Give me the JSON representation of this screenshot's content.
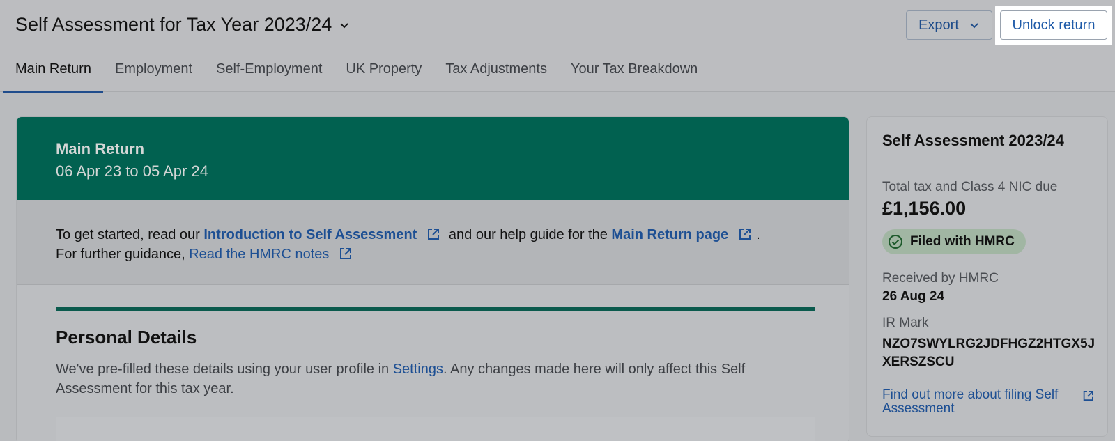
{
  "header": {
    "title": "Self Assessment for Tax Year 2023/24",
    "export_label": "Export",
    "unlock_label": "Unlock return"
  },
  "tabs": [
    {
      "label": "Main Return",
      "active": true
    },
    {
      "label": "Employment",
      "active": false
    },
    {
      "label": "Self-Employment",
      "active": false
    },
    {
      "label": "UK Property",
      "active": false
    },
    {
      "label": "Tax Adjustments",
      "active": false
    },
    {
      "label": "Your Tax Breakdown",
      "active": false
    }
  ],
  "main": {
    "banner_title": "Main Return",
    "banner_dates": "06 Apr 23 to 05 Apr 24",
    "intro": {
      "text1": "To get started, read our",
      "link1": "Introduction to Self Assessment",
      "text2": "and our help guide for the",
      "link2": "Main Return page",
      "text3": ".",
      "text4": "For further guidance,",
      "link3": "Read the HMRC notes"
    },
    "section_title": "Personal Details",
    "section_text1": "We've pre-filled these details using your user profile in",
    "section_link": "Settings",
    "section_text2": ". Any changes made here will only affect this Self Assessment for this tax year."
  },
  "sidebar": {
    "title": "Self Assessment 2023/24",
    "total_label": "Total tax and Class 4 NIC due",
    "total_value": "£1,156.00",
    "status_badge": "Filed with HMRC",
    "received_label": "Received by HMRC",
    "received_value": "26 Aug 24",
    "irmark_label": "IR Mark",
    "irmark_value": "NZO7SWYLRG2JDFHGZ2HTGX5JXERSZSCU",
    "link_label": "Find out more about filing Self Assessment"
  },
  "colors": {
    "brand_green": "#016150",
    "link_blue": "#1d4f93",
    "overlay_grey": "#b9bbbe"
  }
}
